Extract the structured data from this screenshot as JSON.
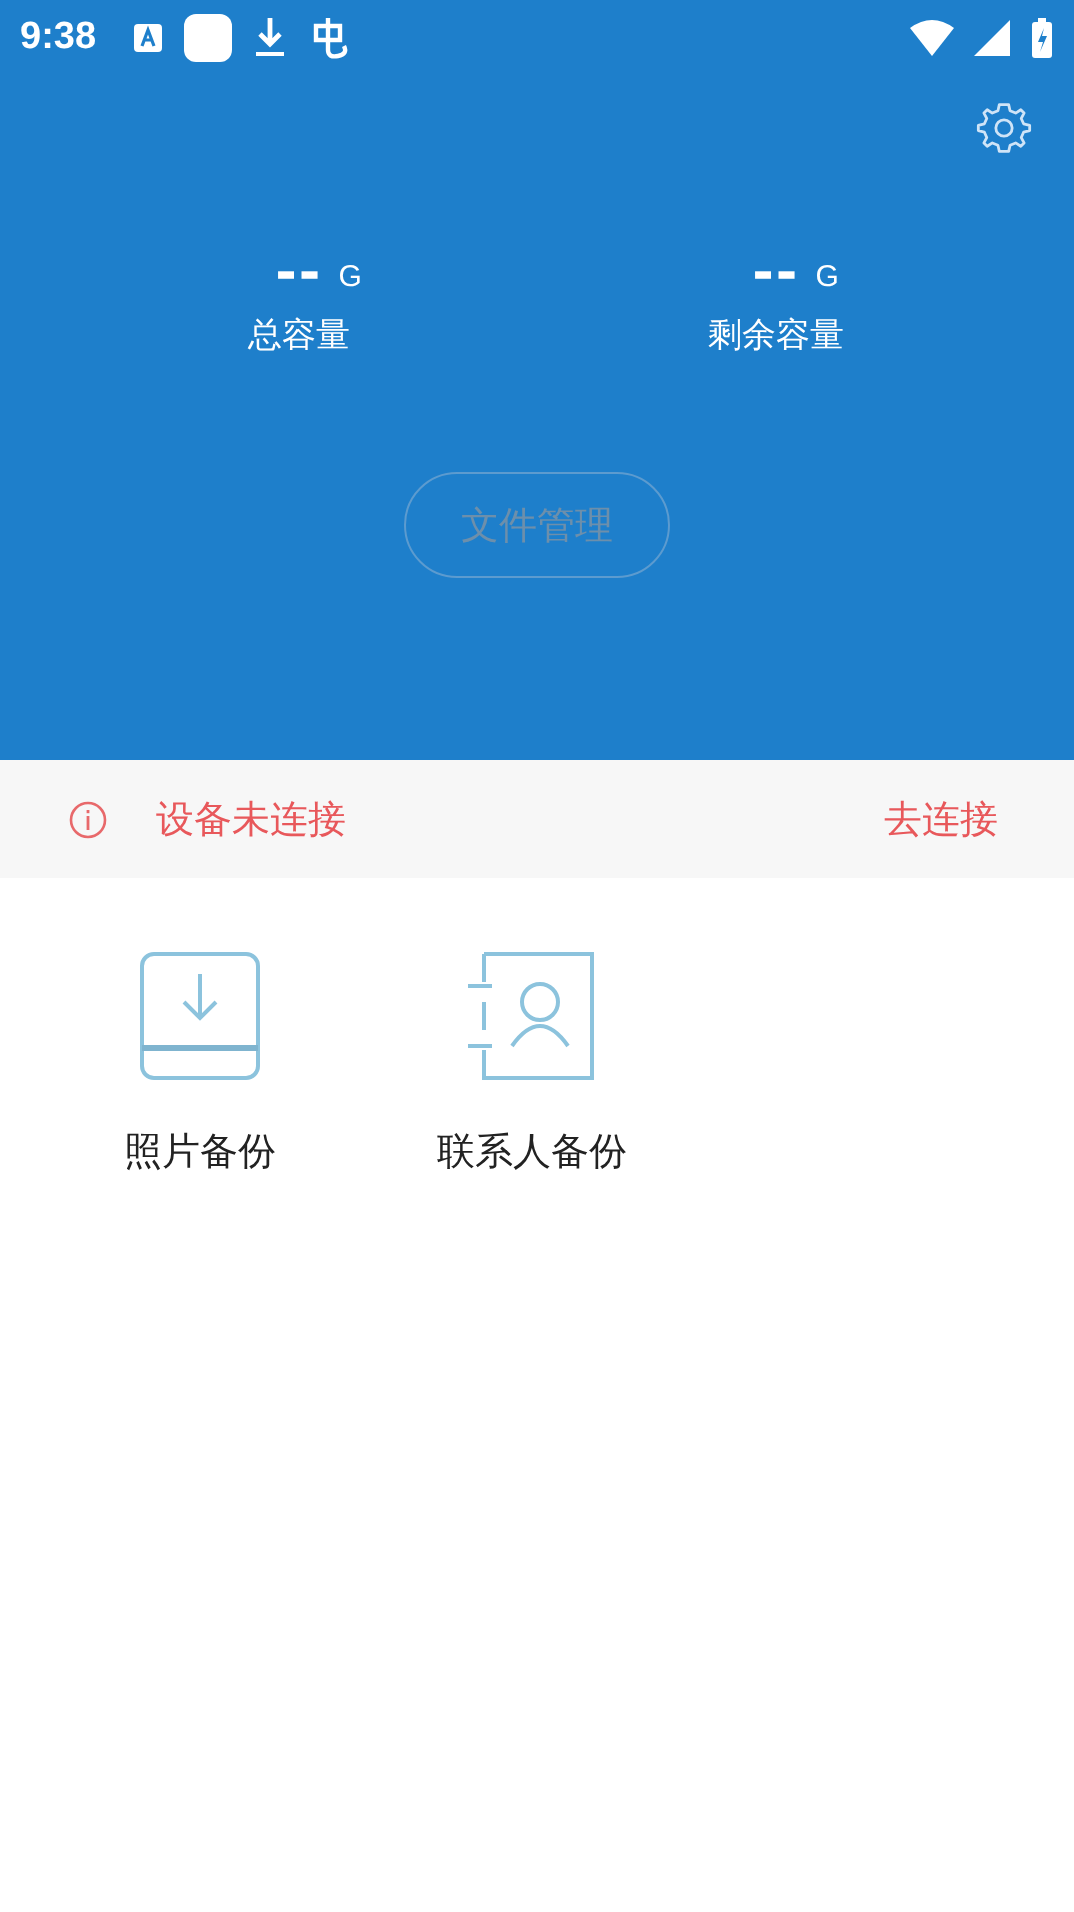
{
  "status_bar": {
    "time": "9:38"
  },
  "storage": [
    {
      "value": "--",
      "unit": "G",
      "label": "总容量"
    },
    {
      "value": "--",
      "unit": "G",
      "label": "剩余容量"
    }
  ],
  "file_button": {
    "label": "文件管理",
    "disabled": true
  },
  "alert": {
    "message": "设备未连接",
    "action": "去连接"
  },
  "tiles": [
    {
      "kind": "photo",
      "label": "照片备份"
    },
    {
      "kind": "contacts",
      "label": "联系人备份"
    }
  ]
}
